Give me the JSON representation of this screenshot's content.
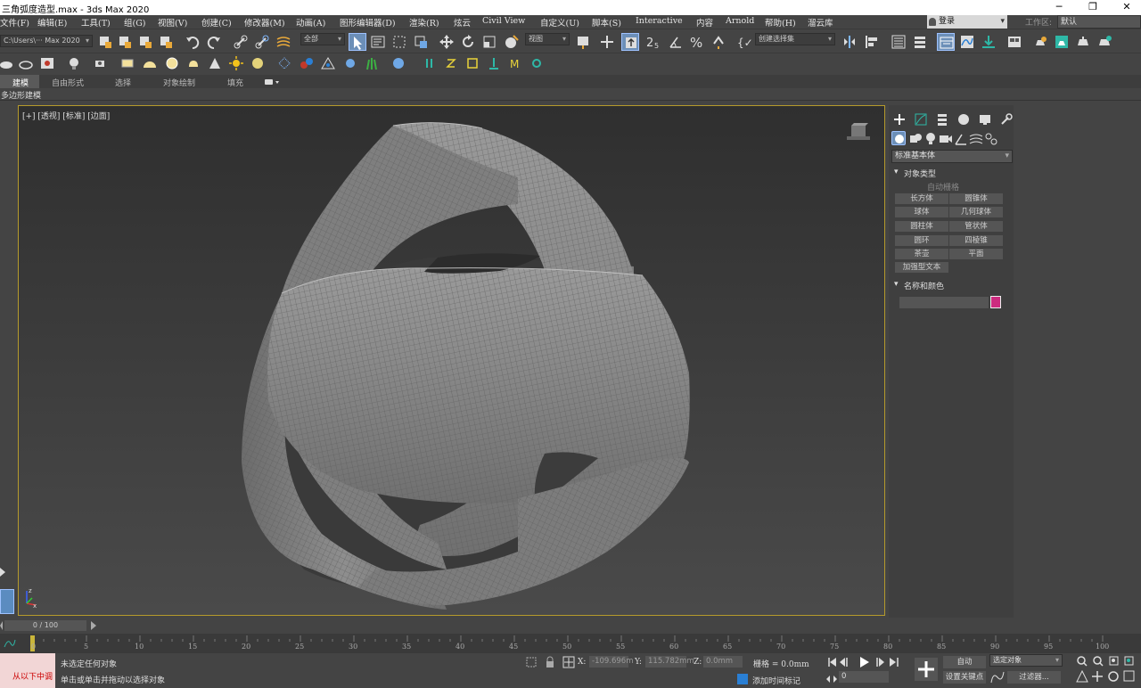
{
  "window": {
    "title": "三角弧度造型.max - 3ds Max 2020",
    "min": "─",
    "max": "❐",
    "close": "✕"
  },
  "menu": [
    "文件(F)",
    "编辑(E)",
    "工具(T)",
    "组(G)",
    "视图(V)",
    "创建(C)",
    "修改器(M)",
    "动画(A)",
    "图形编辑器(D)",
    "渲染(R)",
    "炫云",
    "Civil View",
    "自定义(U)",
    "脚本(S)",
    "Interactive",
    "内容",
    "Arnold",
    "帮助(H)",
    "溜云库"
  ],
  "login": "登录",
  "workspace": {
    "label": "工作区:",
    "value": "默认"
  },
  "toolbar1": {
    "path": "C:\\Users\\··· Max 2020",
    "filter": "全部",
    "refcoord": "视图",
    "selset": "创建选择集"
  },
  "ribbon": {
    "tabs": [
      "建模",
      "自由形式",
      "选择",
      "对象绘制",
      "填充"
    ],
    "active": "建模",
    "sub": "多边形建模"
  },
  "viewport": {
    "label": "[+] [透视] [标准] [边面]",
    "axis_z": "z",
    "axis_x": "x"
  },
  "command": {
    "category": "标准基本体",
    "rollout_object_type": "对象类型",
    "autogrid": "自动栅格",
    "buttons": [
      "长方体",
      "圆锥体",
      "球体",
      "几何球体",
      "圆柱体",
      "管状体",
      "圆环",
      "四棱锥",
      "茶壶",
      "平面",
      "加强型文本"
    ],
    "rollout_name_color": "名称和颜色",
    "color": "#cc2b7f"
  },
  "timeline": {
    "slider": "0 / 100",
    "ticks": [
      "0",
      "5",
      "10",
      "15",
      "20",
      "25",
      "30",
      "35",
      "40",
      "45",
      "50",
      "55",
      "60",
      "65",
      "70",
      "75",
      "80",
      "85",
      "90",
      "95",
      "100"
    ]
  },
  "status": {
    "mini_label": "从以下中调",
    "line1": "未选定任何对象",
    "line2": "单击或单击并拖动以选择对象",
    "x_label": "X:",
    "x": "-109.696m",
    "y_label": "Y:",
    "y": "115.782mm",
    "z_label": "Z:",
    "z": "0.0mm",
    "grid": "栅格 = 0.0mm",
    "add_time_tag": "添加时间标记",
    "auto": "自动",
    "selected": "选定对象",
    "set_key": "设置关键点",
    "filters": "过滤器...",
    "frame": "0"
  }
}
